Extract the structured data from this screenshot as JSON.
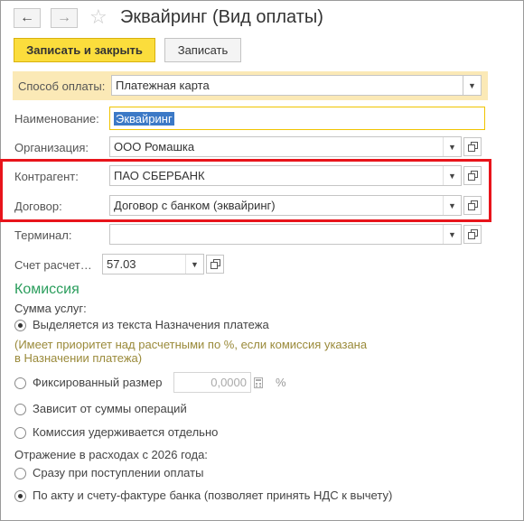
{
  "window": {
    "title": "Эквайринг (Вид оплаты)"
  },
  "nav": {
    "back_icon": "arrow-left-icon",
    "forward_icon": "arrow-right-icon",
    "favorite_icon": "star-icon"
  },
  "toolbar": {
    "save_close_label": "Записать и закрыть",
    "save_label": "Записать"
  },
  "form": {
    "payment_method": {
      "label": "Способ оплаты:",
      "value": "Платежная карта"
    },
    "name": {
      "label": "Наименование:",
      "value": "Эквайринг"
    },
    "organization": {
      "label": "Организация:",
      "value": "ООО Ромашка"
    },
    "counterparty": {
      "label": "Контрагент:",
      "value": "ПАО СБЕРБАНК"
    },
    "contract": {
      "label": "Договор:",
      "value": "Договор с банком (эквайринг)"
    },
    "terminal": {
      "label": "Терминал:",
      "value": ""
    },
    "account": {
      "label": "Счет расчет…",
      "value": "57.03"
    }
  },
  "commission": {
    "section_title": "Комиссия",
    "services_label": "Сумма услуг:",
    "options": [
      {
        "label": "Выделяется из текста Назначения платежа",
        "selected": true
      },
      {
        "label": "Фиксированный размер",
        "selected": false
      },
      {
        "label": "Зависит от суммы операций",
        "selected": false
      },
      {
        "label": "Комиссия удерживается отдельно",
        "selected": false
      }
    ],
    "note_line1": "(Имеет приоритет над расчетными по %, если комиссия указана",
    "note_line2": "в Назначении платежа)",
    "fixed_value": "0,0000",
    "percent_sign": "%"
  },
  "expenses": {
    "label": "Отражение в расходах с 2026 года:",
    "options": [
      {
        "label": "Сразу при поступлении оплаты",
        "selected": false
      },
      {
        "label": "По акту и счету-фактуре банка (позволяет принять НДС к вычету)",
        "selected": true
      }
    ]
  },
  "colors": {
    "accent_yellow": "#fbdd3c",
    "highlight_row": "#fbe9b6",
    "annotation_red": "#e8141b",
    "section_green": "#2a9d5c"
  }
}
